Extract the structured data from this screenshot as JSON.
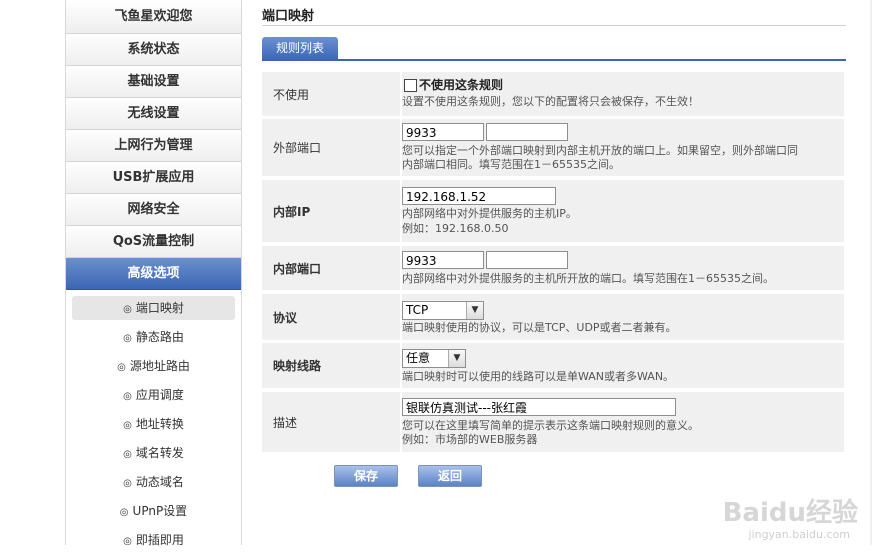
{
  "sidebar": {
    "items": [
      {
        "label": "飞鱼星欢迎您"
      },
      {
        "label": "系统状态"
      },
      {
        "label": "基础设置"
      },
      {
        "label": "无线设置"
      },
      {
        "label": "上网行为管理"
      },
      {
        "label": "USB扩展应用"
      },
      {
        "label": "网络安全"
      },
      {
        "label": "QoS流量控制"
      },
      {
        "label": "高级选项"
      }
    ],
    "subitems": [
      {
        "label": "端口映射"
      },
      {
        "label": "静态路由"
      },
      {
        "label": "源地址路由"
      },
      {
        "label": "应用调度"
      },
      {
        "label": "地址转换"
      },
      {
        "label": "域名转发"
      },
      {
        "label": "动态域名"
      },
      {
        "label": "UPnP设置"
      },
      {
        "label": "即插即用"
      }
    ],
    "bullet": "◎"
  },
  "main": {
    "title": "端口映射",
    "tab": "规则列表",
    "disable": {
      "label": "不使用",
      "checkbox_label": "不使用这条规则",
      "hint": "设置不使用这条规则，您以下的配置将只会被保存，不生效！"
    },
    "external_port": {
      "label": "外部端口",
      "value1": "9933",
      "value2": "",
      "hint_line1": "您可以指定一个外部端口映射到内部主机开放的端口上。如果留空，则外部端口同",
      "hint_line2": "内部端口相同。填写范围在1－65535之间。"
    },
    "internal_ip": {
      "label": "内部IP",
      "value": "192.168.1.52",
      "hint_line1": "内部网络中对外提供服务的主机IP。",
      "hint_line2": "例如：192.168.0.50"
    },
    "internal_port": {
      "label": "内部端口",
      "value1": "9933",
      "value2": "",
      "hint": "内部网络中对外提供服务的主机所开放的端口。填写范围在1－65535之间。"
    },
    "protocol": {
      "label": "协议",
      "selected": "TCP",
      "hint": "端口映射使用的协议，可以是TCP、UDP或者二者兼有。"
    },
    "route": {
      "label": "映射线路",
      "selected": "任意",
      "hint": "端口映射时可以使用的线路可以是单WAN或者多WAN。"
    },
    "description": {
      "label": "描述",
      "value": "银联仿真测试---张红霞",
      "hint_line1": "您可以在这里填写简单的提示表示这条端口映射规则的意义。",
      "hint_line2": "例如：市场部的WEB服务器"
    },
    "save_label": "保存",
    "back_label": "返回"
  },
  "watermark": {
    "text": "Baidu经验",
    "sub": "jingyan.baidu.com"
  },
  "colors": {
    "accent": "#3c66b5",
    "row_bg": "#f0f0f0"
  }
}
